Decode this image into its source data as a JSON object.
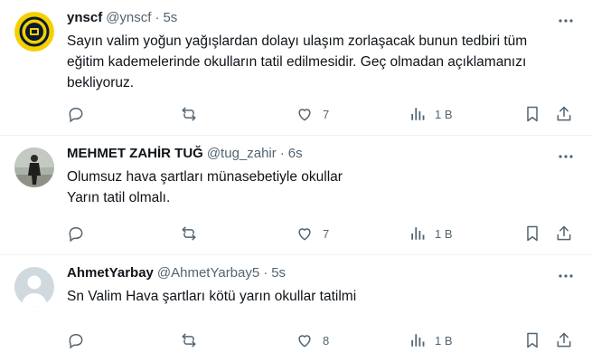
{
  "tweets": [
    {
      "name": "ynscf",
      "handle": "@ynscf",
      "separator": "·",
      "time": "5s",
      "text_lines": [
        "Sayın valim yoğun yağışlardan dolayı ulaşım zorlaşacak bunun tedbiri tüm",
        "eğitim kademelerinde okulların tatil edilmesidir. Geç olmadan açıklamanızı",
        "bekliyoruz."
      ],
      "likes": "7",
      "views": "1 B"
    },
    {
      "name": "MEHMET ZAHİR TUĞ",
      "handle": "@tug_zahir",
      "separator": "·",
      "time": "6s",
      "text_lines": [
        "Olumsuz hava şartları münasebetiyle okullar",
        "Yarın tatil olmalı."
      ],
      "likes": "7",
      "views": "1 B"
    },
    {
      "name": "AhmetYarbay",
      "handle": "@AhmetYarbay5",
      "separator": "·",
      "time": "5s",
      "text_lines": [
        "Sn Valim Hava şartları kötü yarın okullar tatilmi"
      ],
      "likes": "8",
      "views": "1 B"
    }
  ],
  "colors": {
    "text_primary": "#0f1419",
    "text_secondary": "#536471",
    "divider": "#eff3f4",
    "avatar1_bg": "#f5d000",
    "avatar1_ring": "#0b1a33",
    "avatar3_bg": "#cfd9de"
  },
  "icons": [
    "reply-icon",
    "retweet-icon",
    "like-icon",
    "views-icon",
    "bookmark-icon",
    "share-icon",
    "more-icon"
  ]
}
